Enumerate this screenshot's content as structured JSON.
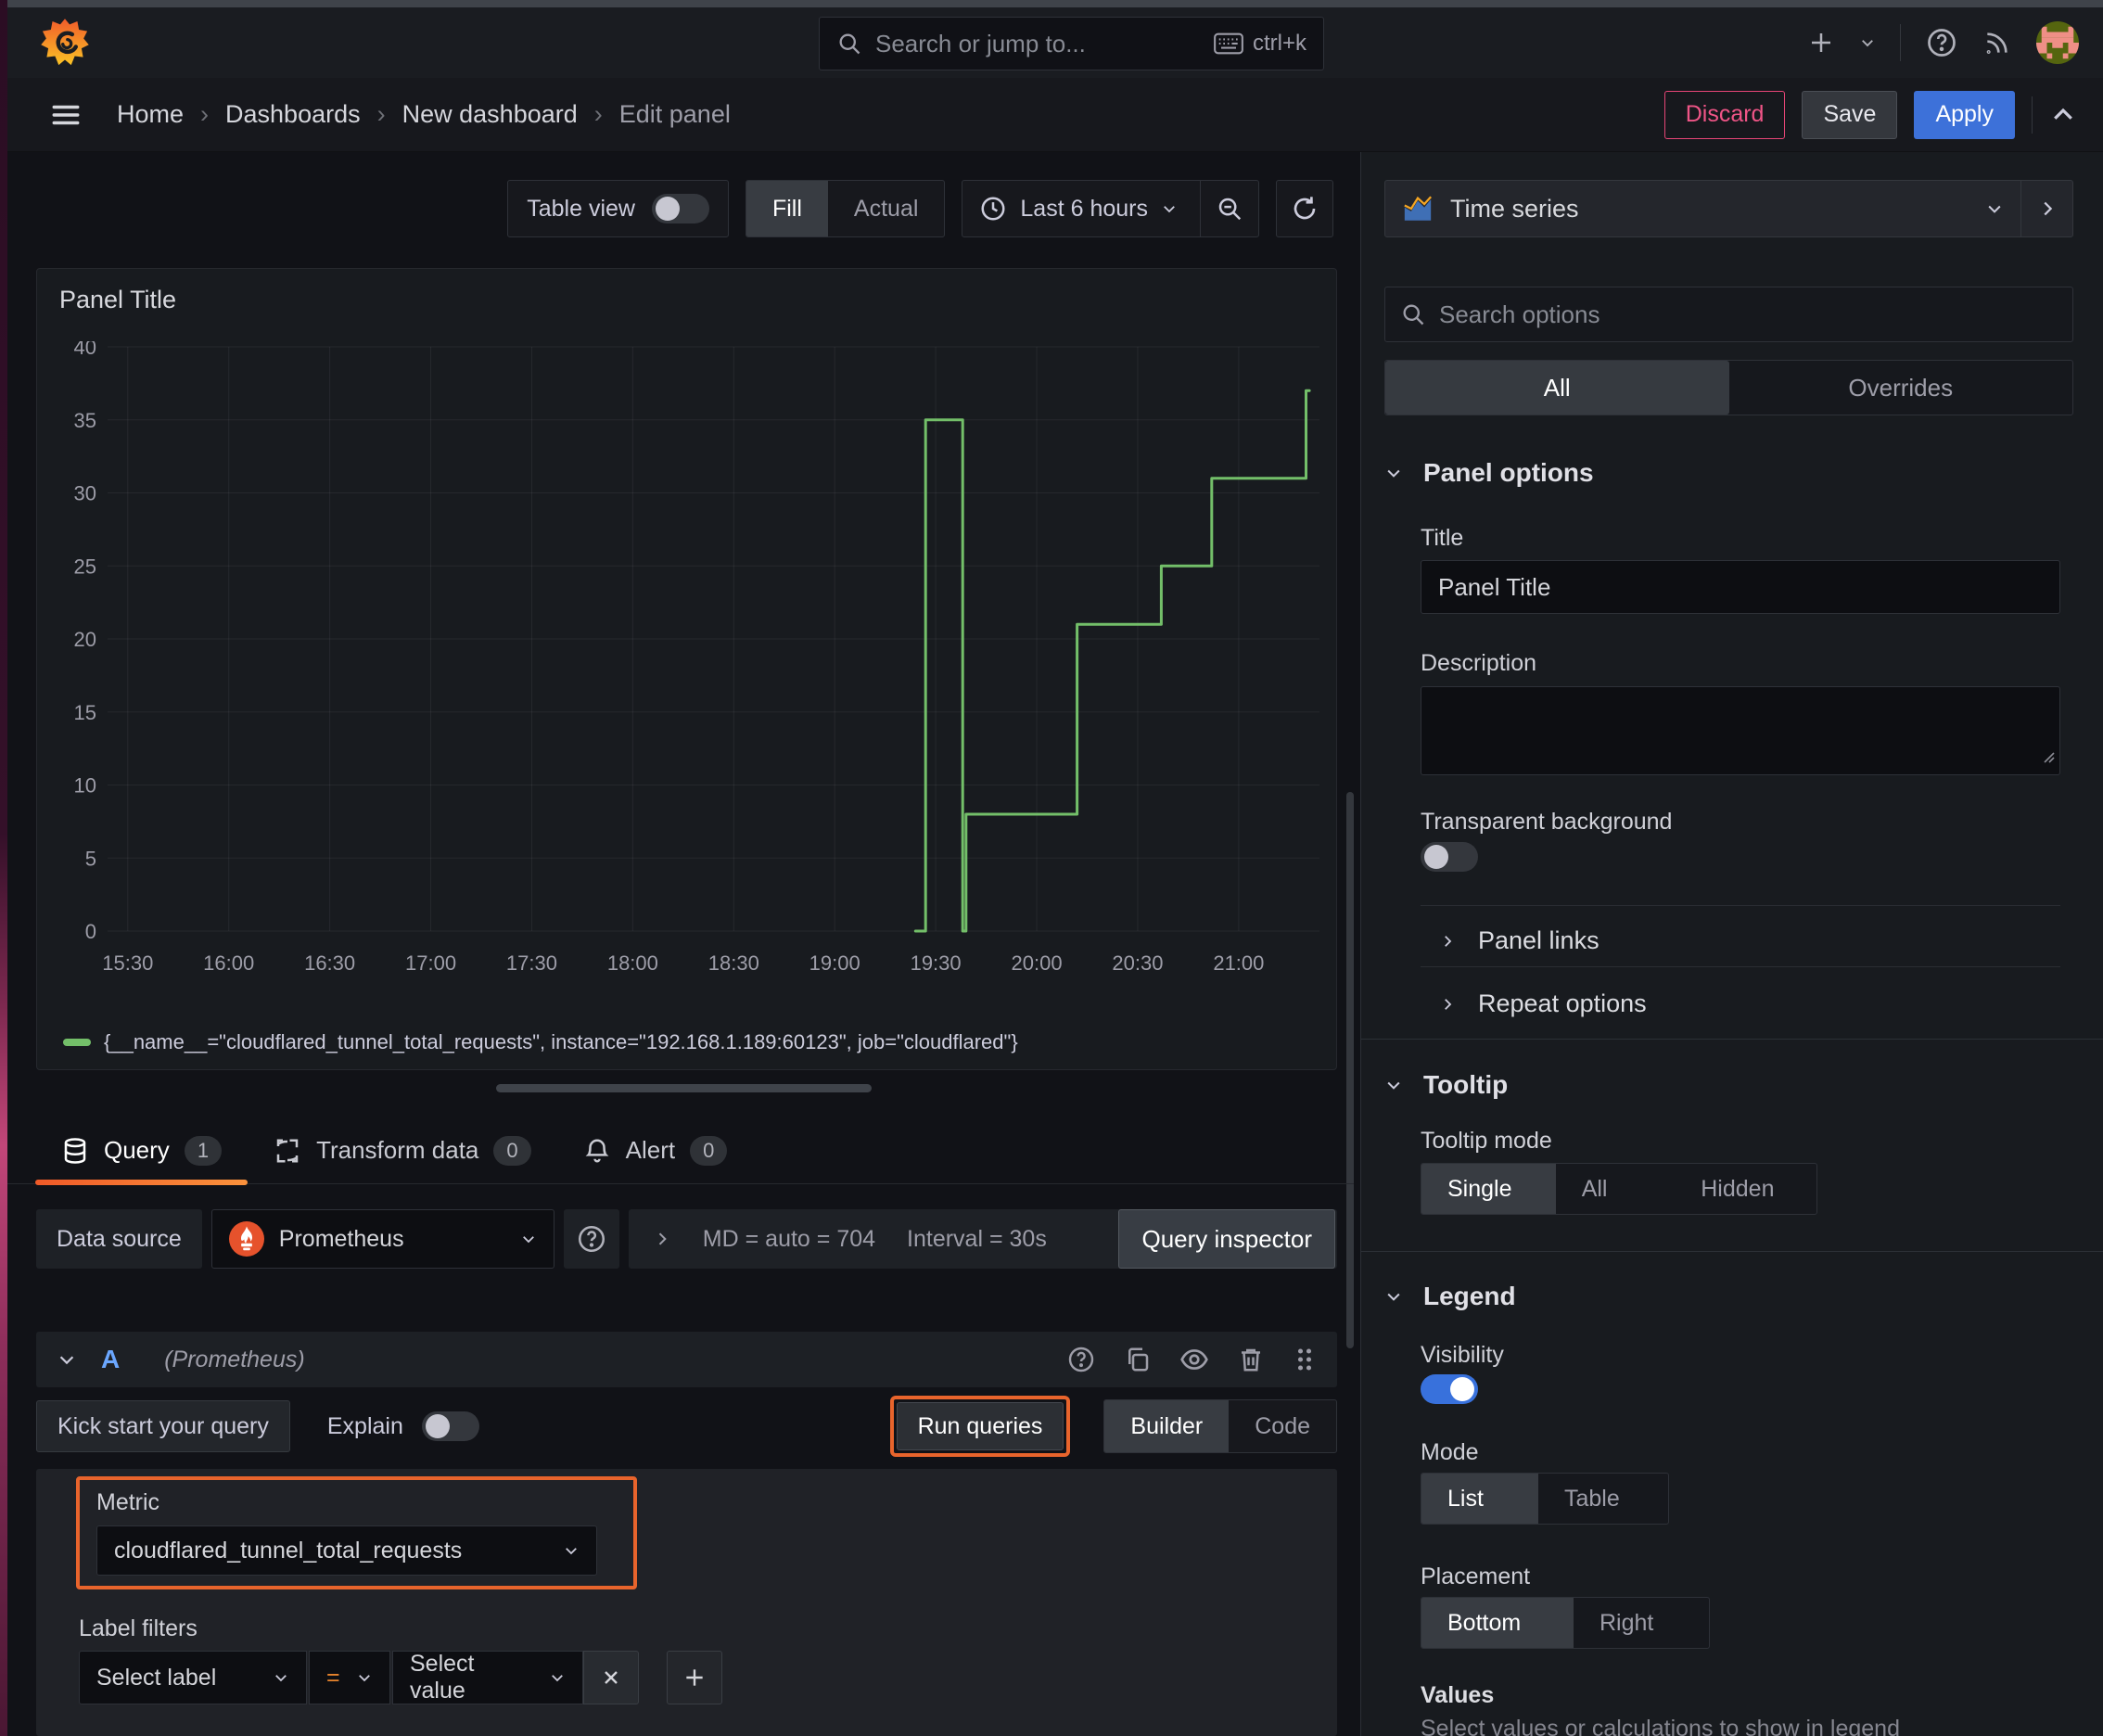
{
  "topbar": {
    "search_placeholder": "Search or jump to...",
    "shortcut": "ctrl+k"
  },
  "breadcrumb": {
    "items": [
      "Home",
      "Dashboards",
      "New dashboard",
      "Edit panel"
    ]
  },
  "actions": {
    "discard": "Discard",
    "save": "Save",
    "apply": "Apply"
  },
  "toolbar": {
    "table_view": "Table view",
    "fill": "Fill",
    "actual": "Actual",
    "time_range": "Last 6 hours"
  },
  "viz_picker": {
    "label": "Time series"
  },
  "panel": {
    "title": "Panel Title"
  },
  "chart_data": {
    "type": "line",
    "title": "Panel Title",
    "xlabel": "",
    "ylabel": "",
    "ylim": [
      0,
      40
    ],
    "y_tick_step": 5,
    "grid": true,
    "legend_position": "bottom",
    "x_domain_minutes": [
      924,
      1284
    ],
    "x_ticks": [
      {
        "m": 930,
        "label": "15:30"
      },
      {
        "m": 960,
        "label": "16:00"
      },
      {
        "m": 990,
        "label": "16:30"
      },
      {
        "m": 1020,
        "label": "17:00"
      },
      {
        "m": 1050,
        "label": "17:30"
      },
      {
        "m": 1080,
        "label": "18:00"
      },
      {
        "m": 1110,
        "label": "18:30"
      },
      {
        "m": 1140,
        "label": "19:00"
      },
      {
        "m": 1170,
        "label": "19:30"
      },
      {
        "m": 1200,
        "label": "20:00"
      },
      {
        "m": 1230,
        "label": "20:30"
      },
      {
        "m": 1260,
        "label": "21:00"
      }
    ],
    "series": [
      {
        "name": "{__name__=\"cloudflared_tunnel_total_requests\", instance=\"192.168.1.189:60123\", job=\"cloudflared\"}",
        "color": "#73bf69",
        "points": [
          [
            1164,
            0
          ],
          [
            1167,
            0
          ],
          [
            1167,
            35
          ],
          [
            1178,
            35
          ],
          [
            1178,
            0
          ],
          [
            1179,
            0
          ],
          [
            1179,
            8
          ],
          [
            1212,
            8
          ],
          [
            1212,
            21
          ],
          [
            1237,
            21
          ],
          [
            1237,
            25
          ],
          [
            1252,
            25
          ],
          [
            1252,
            31
          ],
          [
            1280,
            31
          ],
          [
            1280,
            37
          ],
          [
            1281,
            37
          ]
        ]
      }
    ]
  },
  "sidebar": {
    "search_placeholder": "Search options",
    "tabs": {
      "all": "All",
      "overrides": "Overrides"
    },
    "panel_options": {
      "heading": "Panel options",
      "title_label": "Title",
      "title_value": "Panel Title",
      "description_label": "Description",
      "transparent_label": "Transparent background"
    },
    "panel_links": "Panel links",
    "repeat_options": "Repeat options",
    "tooltip": {
      "heading": "Tooltip",
      "mode_label": "Tooltip mode",
      "single": "Single",
      "all": "All",
      "hidden": "Hidden"
    },
    "legend": {
      "heading": "Legend",
      "visibility_label": "Visibility",
      "mode_label": "Mode",
      "list": "List",
      "table": "Table",
      "placement_label": "Placement",
      "bottom": "Bottom",
      "right": "Right",
      "values_label": "Values",
      "values_help": "Select values or calculations to show in legend"
    }
  },
  "query_section": {
    "tabs": [
      {
        "label": "Query",
        "count": "1"
      },
      {
        "label": "Transform data",
        "count": "0"
      },
      {
        "label": "Alert",
        "count": "0"
      }
    ],
    "datasource": {
      "label": "Data source",
      "name": "Prometheus",
      "max_data_points": "MD = auto = 704",
      "interval": "Interval = 30s",
      "inspector": "Query inspector"
    },
    "query_row": {
      "ref": "A",
      "hint": "(Prometheus)"
    },
    "kickstart": "Kick start your query",
    "explain_label": "Explain",
    "run_label": "Run queries",
    "builder": "Builder",
    "code": "Code",
    "metric": {
      "label": "Metric",
      "value": "cloudflared_tunnel_total_requests"
    },
    "label_filters": {
      "label": "Label filters",
      "select_label": "Select label",
      "operator": "=",
      "select_value": "Select value"
    }
  },
  "colors": {
    "accent_blue": "#3d71d9",
    "highlight_orange": "#e8642c",
    "discard_pink": "#e64576",
    "series_green": "#73bf69"
  }
}
